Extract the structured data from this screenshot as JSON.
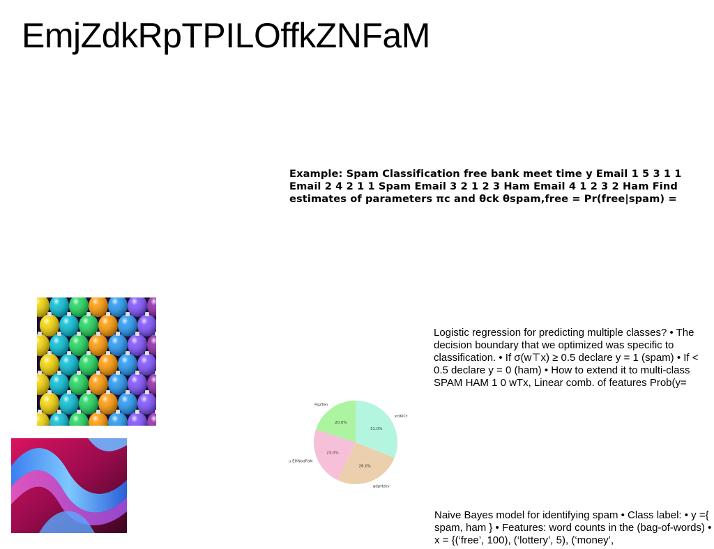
{
  "slide": {
    "title": "EmjZdkRpTPILOffkZNFaM",
    "spam_example_text": "Example: Spam Classification free bank meet time y Email 1 5 3 1 1 Email 2 4 2 1 1 Spam Email 3 2 1 2 3 Ham Email 4 1 2 3 2 Ham Find estimates of parameters πc and θck θspam,free = Pr(free|spam) =",
    "logreg_text": "Logistic regression for predicting multiple classes? • The decision boundary that we optimized was specific to classification. • If σ(w⊤x) ≥ 0.5 declare y = 1 (spam) • If < 0.5 declare y = 0 (ham) • How to extend it to multi-class SPAM HAM 1 0 wTx, Linear comb. of features Prob(y=",
    "naive_bayes_text": "Naive Bayes model for identifying spam • Class label: • y ={ spam, ham } • Features: word counts in the (bag-of-words) • x = {(‘free’, 100), (‘lottery’, 5), (‘money’,"
  },
  "images": {
    "ornaments": "colorful-christmas-ornaments-photo",
    "waves": "abstract-blue-pink-waves-art"
  },
  "chart_data": {
    "type": "pie",
    "slices": [
      {
        "label": "xciKlCt",
        "value": 31.0,
        "pct_label": "31.0%",
        "color": "#b3f5df"
      },
      {
        "label": "qdpHzkv",
        "value": 26.0,
        "pct_label": "26.0%",
        "color": "#ecd0ad"
      },
      {
        "label": "u EHNodPaN",
        "value": 23.0,
        "pct_label": "23.0%",
        "color": "#f6c0d8"
      },
      {
        "label": "PqZfen",
        "value": 20.0,
        "pct_label": "20.0%",
        "color": "#acf4a0"
      }
    ],
    "start_angle_deg": 90,
    "direction": "clockwise"
  }
}
